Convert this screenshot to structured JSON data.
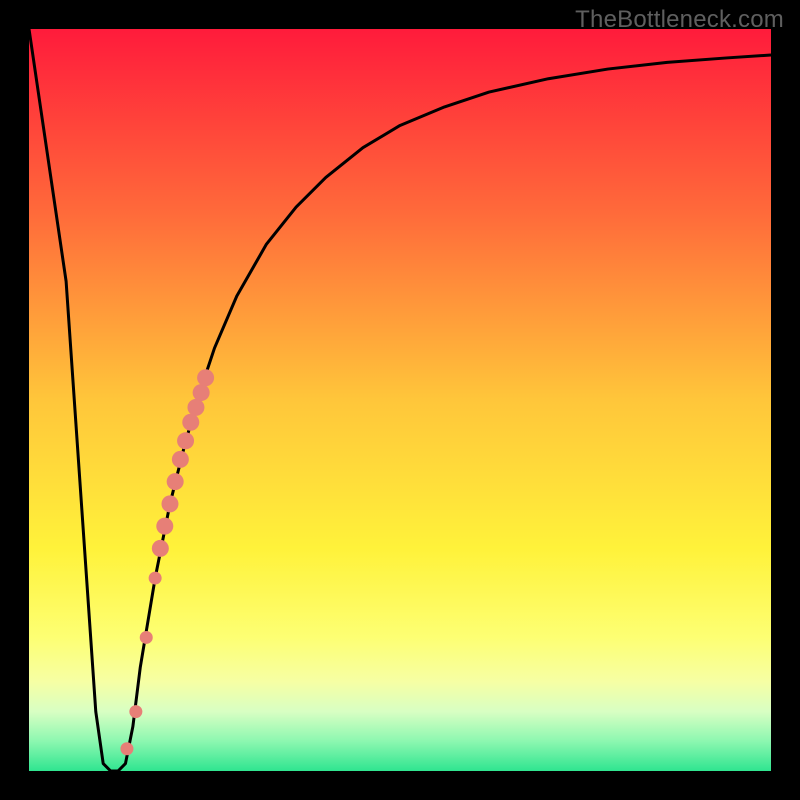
{
  "watermark": "TheBottleneck.com",
  "colors": {
    "frame": "#000000",
    "curve": "#000000",
    "marker": "#e77f77",
    "gradient_stops": [
      {
        "offset": 0,
        "color": "#ff1b3b"
      },
      {
        "offset": 0.25,
        "color": "#ff6b3a"
      },
      {
        "offset": 0.5,
        "color": "#ffc63a"
      },
      {
        "offset": 0.7,
        "color": "#fff23a"
      },
      {
        "offset": 0.82,
        "color": "#fdff73"
      },
      {
        "offset": 0.88,
        "color": "#f6ffa4"
      },
      {
        "offset": 0.92,
        "color": "#d8ffc3"
      },
      {
        "offset": 0.96,
        "color": "#8cf7b0"
      },
      {
        "offset": 1.0,
        "color": "#2fe590"
      }
    ]
  },
  "chart_data": {
    "type": "line",
    "title": "",
    "xlabel": "",
    "ylabel": "",
    "xlim": [
      0,
      100
    ],
    "ylim": [
      0,
      100
    ],
    "series": [
      {
        "name": "bottleneck-curve",
        "x": [
          0,
          5,
          9,
          10,
          11,
          12,
          13,
          14,
          15,
          17,
          19,
          21,
          23,
          25,
          28,
          32,
          36,
          40,
          45,
          50,
          56,
          62,
          70,
          78,
          86,
          94,
          100
        ],
        "values": [
          100,
          66,
          8,
          1,
          0,
          0,
          1,
          6,
          14,
          26,
          36,
          44,
          51,
          57,
          64,
          71,
          76,
          80,
          84,
          87,
          89.5,
          91.5,
          93.3,
          94.6,
          95.5,
          96.1,
          96.5
        ]
      }
    ],
    "markers": {
      "name": "highlighted-points",
      "x": [
        13.2,
        14.4,
        15.8,
        17.0,
        17.7,
        18.3,
        19.0,
        19.7,
        20.4,
        21.1,
        21.8,
        22.5,
        23.2,
        23.8
      ],
      "values": [
        3.0,
        8.0,
        18.0,
        26.0,
        30.0,
        33.0,
        36.0,
        39.0,
        42.0,
        44.5,
        47.0,
        49.0,
        51.0,
        53.0
      ],
      "radius": [
        6.5,
        6.5,
        6.5,
        6.5,
        8.5,
        8.5,
        8.5,
        8.5,
        8.5,
        8.5,
        8.5,
        8.5,
        8.5,
        8.5
      ]
    }
  }
}
